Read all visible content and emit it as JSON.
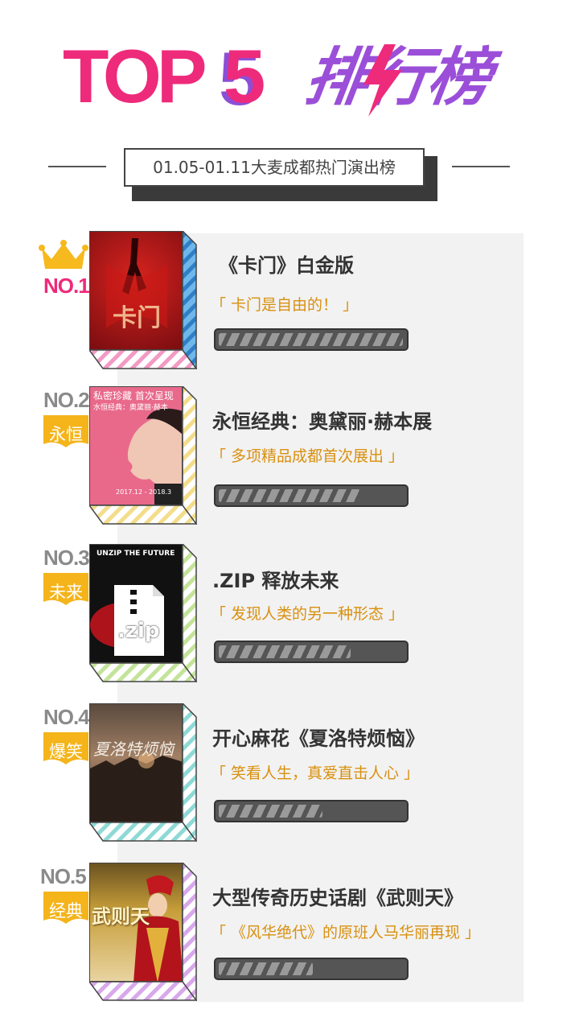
{
  "header": {
    "title_top": "TOP",
    "title_num": "5",
    "title_cn": "排行榜",
    "subtitle": "01.05-01.11大麦成都热门演出榜"
  },
  "colors": {
    "accent_pink": "#ee2a7b",
    "accent_purple": "#9b4fd8",
    "quote_orange": "#d9900f",
    "tag_yellow": "#f4b41a",
    "crown_yellow": "#f6b91e"
  },
  "items": [
    {
      "rank": "NO.1",
      "tag": "",
      "title": "《卡门》白金版",
      "quote": "「 卡门是自由的！ 」",
      "side_color": "#6fb7ea",
      "stripe_color": "#f39ac4",
      "poster_main": "#a6161b",
      "poster_text": "卡门",
      "progress": 0.98
    },
    {
      "rank": "NO.2",
      "tag": "永恒",
      "title": "永恒经典：奥黛丽·赫本展",
      "quote": "「 多项精品成都首次展出 」",
      "side_color": "#f4dd8a",
      "stripe_color": "#f4dd8a",
      "poster_main": "#e25f83",
      "poster_text": "私密珍藏 首次呈现",
      "poster_sub": "水恒经典：奥黛丽·赫本",
      "poster_date": "2017.12 - 2018.3",
      "progress": 0.75
    },
    {
      "rank": "NO.3",
      "tag": "未来",
      "title": ".ZIP 释放未来",
      "quote": "「 发现人类的另一种形态 」",
      "side_color": "#c4e39a",
      "stripe_color": "#c4e39a",
      "poster_main": "#111111",
      "poster_text": "UNZIP THE FUTURE",
      "poster_zip": ".zip",
      "progress": 0.7
    },
    {
      "rank": "NO.4",
      "tag": "爆笑",
      "title": "开心麻花《夏洛特烦恼》",
      "quote": "「 笑看人生，真爱直击人心 」",
      "side_color": "#8fd9d5",
      "stripe_color": "#8fd9d5",
      "poster_main": "#6d5646",
      "poster_text": "夏洛特烦恼",
      "progress": 0.55
    },
    {
      "rank": "NO.5",
      "tag": "经典",
      "title": "大型传奇历史话剧《武则天》",
      "quote": "「 《风华绝代》的原班人马华丽再现 」",
      "side_color": "#d8a8ea",
      "stripe_color": "#d8a8ea",
      "poster_main": "#b8921f",
      "poster_text": "武则天",
      "progress": 0.5
    }
  ]
}
